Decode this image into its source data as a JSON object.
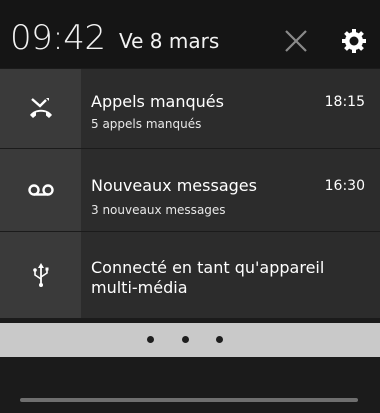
{
  "status_bar": {
    "time": "09:42",
    "date": "Ve 8 mars"
  },
  "notifications": [
    {
      "icon": "missed-call-icon",
      "title": "Appels manqués",
      "subtitle": "5 appels manqués",
      "time": "18:15"
    },
    {
      "icon": "voicemail-icon",
      "title": "Nouveaux messages",
      "subtitle": "3 nouveaux messages",
      "time": "16:30"
    },
    {
      "icon": "usb-icon",
      "title": "Connecté en tant qu'appareil multi-média",
      "subtitle": "",
      "time": ""
    }
  ],
  "pager": {
    "page_count": 3
  },
  "colors": {
    "background": "#1b1b1b",
    "header": "#151515",
    "notification": "#2c2c2c",
    "icon_column": "#3a3a3a",
    "pager_bar": "#c9c9c9"
  }
}
